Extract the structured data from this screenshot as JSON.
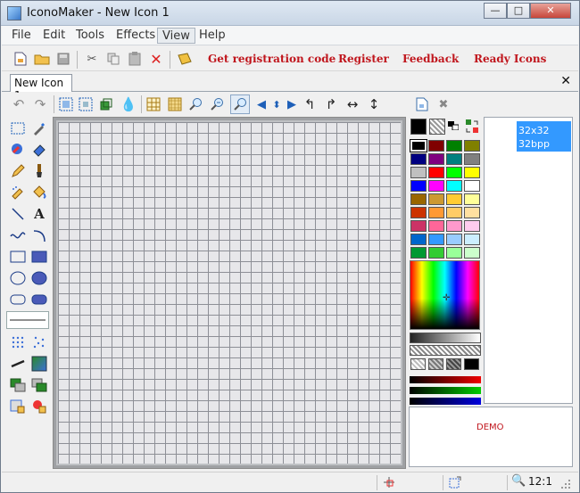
{
  "window": {
    "title": "IconoMaker - New Icon 1",
    "controls": {
      "minimize": "—",
      "maximize": "□",
      "close": "✕"
    }
  },
  "menu": {
    "items": [
      "File",
      "Edit",
      "Tools",
      "Effects",
      "View",
      "Help"
    ],
    "active": "View"
  },
  "toolbar": {
    "links": {
      "get_code": "Get registration code",
      "register": "Register",
      "feedback": "Feedback",
      "ready_icons": "Ready Icons"
    }
  },
  "tab": {
    "label": "New Icon 1",
    "close": "✕"
  },
  "icon_sizes": {
    "selected_size": "32x32",
    "selected_depth": "32bpp"
  },
  "preview": {
    "demo_label": "DEMO"
  },
  "status": {
    "zoom": "12:1"
  },
  "colors": {
    "accent": "#c0161d",
    "selection": "#3399ff",
    "palette": [
      "#000000",
      "#800000",
      "#008000",
      "#808000",
      "#000080",
      "#800080",
      "#008080",
      "#808080",
      "#c0c0c0",
      "#ff0000",
      "#00ff00",
      "#ffff00",
      "#0000ff",
      "#ff00ff",
      "#00ffff",
      "#ffffff",
      "#996600",
      "#cc9933",
      "#ffcc33",
      "#ffff99",
      "#cc3300",
      "#ff9933",
      "#ffcc66",
      "#ffe0a0",
      "#cc3366",
      "#ff6699",
      "#ff99cc",
      "#ffccee",
      "#0066cc",
      "#3399ff",
      "#99ccff",
      "#cceeff",
      "#009933",
      "#33cc33",
      "#99ff99",
      "#ccffcc"
    ]
  }
}
